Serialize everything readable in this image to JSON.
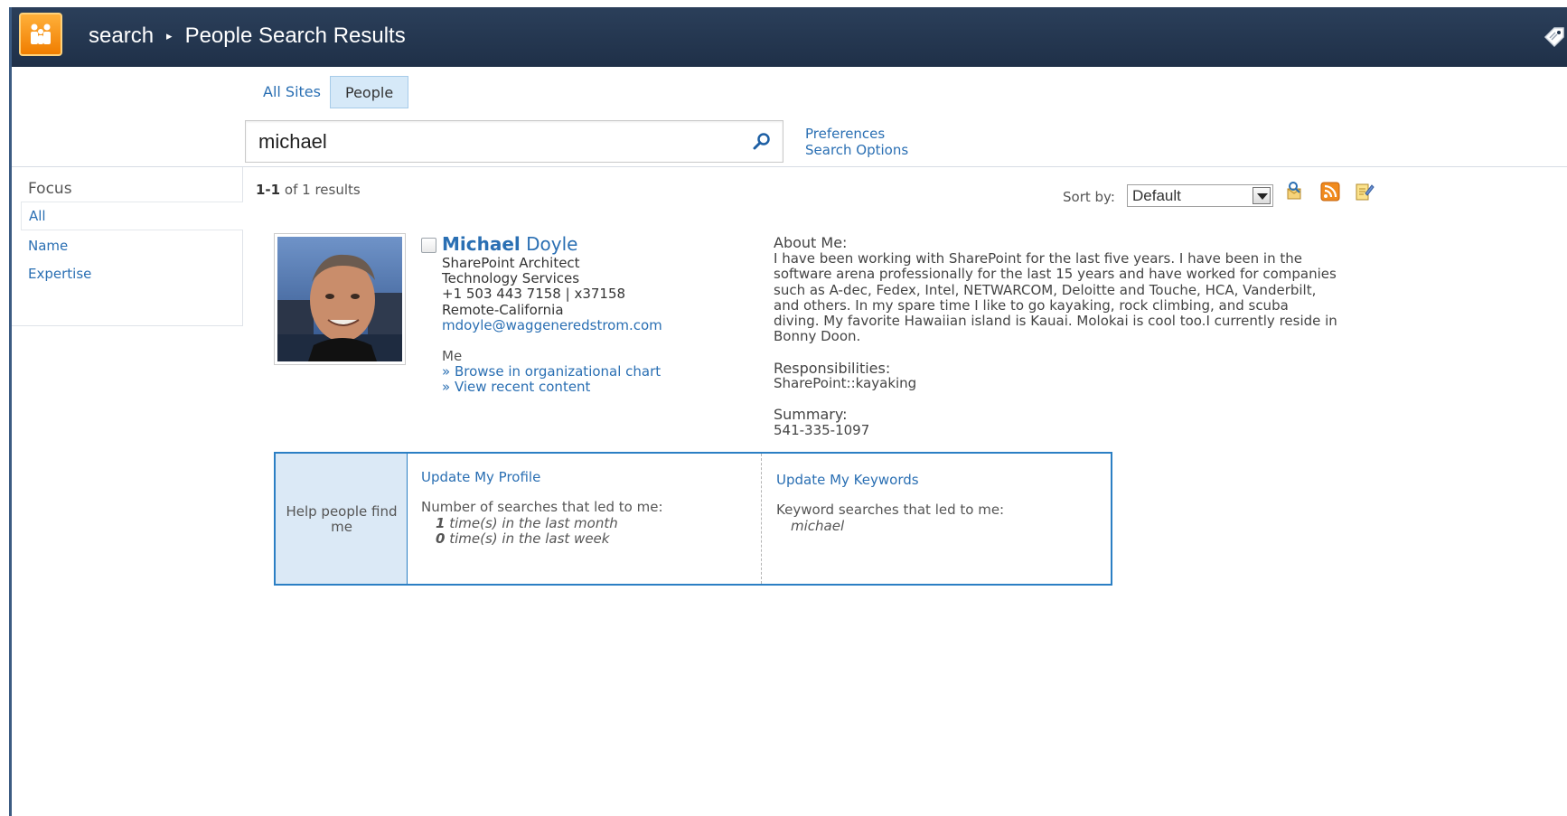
{
  "header": {
    "crumb_root": "search",
    "crumb_separator": "▸",
    "crumb_current": "People Search Results"
  },
  "tabs": [
    {
      "label": "All Sites",
      "selected": false
    },
    {
      "label": "People",
      "selected": true
    }
  ],
  "search": {
    "value": "michael"
  },
  "links": {
    "preferences": "Preferences",
    "search_options": "Search Options"
  },
  "leftnav": {
    "title": "Focus",
    "items": [
      "All",
      "Name",
      "Expertise"
    ]
  },
  "results": {
    "range": "1-1",
    "of": "of",
    "total": "1",
    "suffix": "results",
    "sort_label": "Sort by:",
    "sort_value": "Default"
  },
  "person": {
    "first_name": "Michael",
    "last_name": "Doyle",
    "title": "SharePoint Architect",
    "department": "Technology Services",
    "phone": "+1 503 443 7158 | x37158",
    "location": "Remote-California",
    "email": "mdoyle@waggeneredstrom.com",
    "me_label": "Me",
    "org_chart_link": "» Browse in organizational chart",
    "recent_content_link": "» View recent content",
    "about_label": "About Me:",
    "about_lines": [
      "I have been working with SharePoint for the last five years. I have been in the",
      "software arena professionally for the last 15 years and have worked for companies",
      "such as A-dec, Fedex, Intel, NETWARCOM, Deloitte and Touche, HCA, Vanderbilt,",
      "and others. In my spare time I like to go kayaking, rock climbing, and scuba",
      "diving. My favorite Hawaiian island is Kauai. Molokai is cool too.I currently reside in",
      "Bonny Doon."
    ],
    "responsibilities_label": "Responsibilities:",
    "responsibilities": "SharePoint::kayaking",
    "summary_label": "Summary:",
    "summary": "541-335-1097"
  },
  "helpbox": {
    "label": "Help people find me",
    "update_profile": "Update My Profile",
    "searches_label": "Number of searches that led to me:",
    "month_count": "1",
    "month_text": "time(s) in the last month",
    "week_count": "0",
    "week_text": "time(s) in the last week",
    "update_keywords": "Update My Keywords",
    "keywords_label": "Keyword searches that led to me:",
    "keyword": "michael"
  },
  "colors": {
    "accent": "#2a6fb3",
    "topbar": "#22344d",
    "help_bg": "#dbe9f6",
    "help_border": "#2b7fc4"
  }
}
